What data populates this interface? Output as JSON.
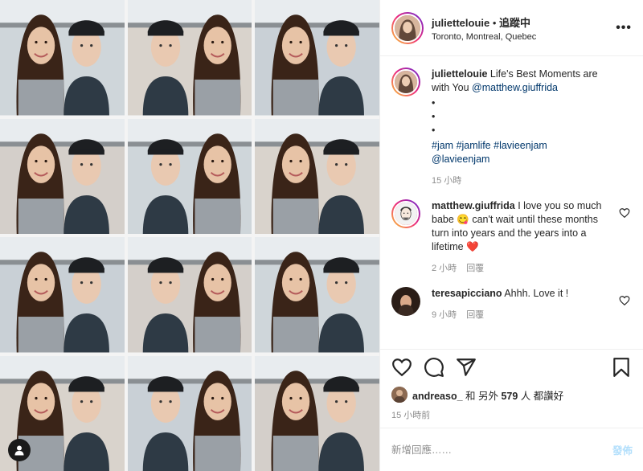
{
  "header": {
    "username": "juliettelouie",
    "follow_sep": " • ",
    "follow_label": "追蹤中",
    "location": "Toronto, Montreal, Quebec",
    "more_label": "•••"
  },
  "caption": {
    "username": "juliettelouie",
    "text": " Life's Best Moments are with You ",
    "mention": "@matthew.giuffrida",
    "bullets": "•\n•\n•",
    "tags": "#jam #jamlife #lavieenjam\n@lavieenjam",
    "time": "15 小時"
  },
  "comments": [
    {
      "username": "matthew.giuffrida",
      "text_before": " I love you so much babe ",
      "emoji_1": "😋",
      "text_after": " can't wait until these months turn into years and the years into a lifetime ",
      "emoji_2": "❤️",
      "time": "2 小時",
      "reply": "回覆"
    },
    {
      "username": "teresapicciano",
      "text": " Ahhh. Love it !",
      "time": "9 小時",
      "reply": "回覆"
    }
  ],
  "likes": {
    "username": "andreaso_",
    "text_mid": " 和 另外 ",
    "count": "579",
    "text_end": " 人 都讚好"
  },
  "post_time": "15 小時前",
  "add_comment": {
    "placeholder": "新增回應……",
    "post_label": "發佈"
  },
  "icons": {
    "like": "heart-icon",
    "comment": "comment-icon",
    "share": "share-icon",
    "save": "bookmark-icon",
    "tag": "user-tag-icon",
    "more": "more-icon"
  },
  "colors": {
    "link": "#00376b",
    "muted": "#8e8e8e",
    "post_disabled": "#b2dffc"
  }
}
